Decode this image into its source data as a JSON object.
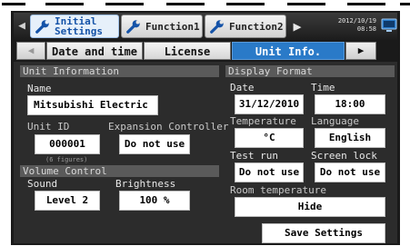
{
  "header": {
    "tabs": [
      {
        "label_line1": "Initial",
        "label_line2": "Settings",
        "icon": "wrench-icon",
        "active": true
      },
      {
        "label": "Function1",
        "icon": "wrench-icon",
        "active": false
      },
      {
        "label": "Function2",
        "icon": "wrench-icon",
        "active": false
      }
    ],
    "date": "2012/10/19",
    "time": "08:58",
    "left_arrow_icon": "left-arrow-icon",
    "next_icon": "play-right-icon",
    "screen_icon": "monitor-icon"
  },
  "subtabs": [
    {
      "label": "Date and time",
      "active": false
    },
    {
      "label": "License",
      "active": false
    },
    {
      "label": "Unit Info.",
      "active": true
    }
  ],
  "unit_info": {
    "heading": "Unit Information",
    "name_label": "Name",
    "name_value": "Mitsubishi Electric",
    "unit_id_label": "Unit ID",
    "unit_id_value": "000001",
    "unit_id_note": "(6 figures)",
    "expansion_label": "Expansion Controller",
    "expansion_value": "Do not use"
  },
  "volume_control": {
    "heading": "Volume Control",
    "sound_label": "Sound",
    "sound_value": "Level 2",
    "brightness_label": "Brightness",
    "brightness_value": "100 %"
  },
  "display_format": {
    "heading": "Display Format",
    "date_label": "Date",
    "date_value": "31/12/2010",
    "time_label": "Time",
    "time_value": "18:00",
    "temperature_label": "Temperature",
    "temperature_value": "°C",
    "language_label": "Language",
    "language_value": "English",
    "test_run_label": "Test run",
    "test_run_value": "Do not use",
    "screen_lock_label": "Screen lock",
    "screen_lock_value": "Do not use",
    "room_temp_label": "Room temperature",
    "room_temp_value": "Hide"
  },
  "actions": {
    "save_label": "Save Settings"
  },
  "colors": {
    "accent_blue": "#2a7ac8",
    "panel": "#2c2c2c",
    "section_header": "#5a5a5a"
  }
}
